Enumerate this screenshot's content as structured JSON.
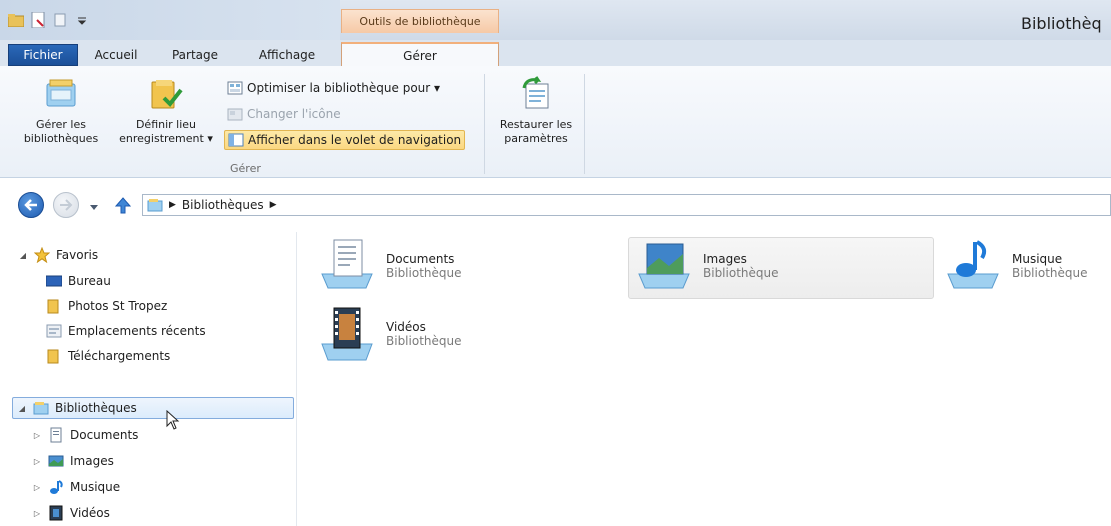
{
  "window": {
    "title": "Bibliothèq",
    "context_header": "Outils de bibliothèque"
  },
  "tabs": [
    {
      "label": "Fichier"
    },
    {
      "label": "Accueil"
    },
    {
      "label": "Partage"
    },
    {
      "label": "Affichage"
    },
    {
      "label": "Gérer"
    }
  ],
  "ribbon": {
    "manage_libraries": {
      "line1": "Gérer les",
      "line2": "bibliothèques"
    },
    "set_save_location": {
      "line1": "Définir lieu",
      "line2": "enregistrement ▾"
    },
    "optimize_library": "Optimiser la bibliothèque pour ▾",
    "change_icon": "Changer l'icône",
    "show_in_nav_pane": "Afficher dans le volet de navigation",
    "group_label": "Gérer",
    "restore_settings": {
      "line1": "Restaurer les",
      "line2": "paramètres"
    }
  },
  "address": {
    "crumb": "Bibliothèques"
  },
  "nav": {
    "favorites": "Favoris",
    "favorites_items": [
      "Bureau",
      "Photos St Tropez",
      "Emplacements récents",
      "Téléchargements"
    ],
    "libraries": "Bibliothèques",
    "libraries_items": [
      "Documents",
      "Images",
      "Musique",
      "Vidéos"
    ]
  },
  "content": {
    "tiles": [
      {
        "name": "Documents",
        "type": "Bibliothèque"
      },
      {
        "name": "Images",
        "type": "Bibliothèque"
      },
      {
        "name": "Musique",
        "type": "Bibliothèque"
      },
      {
        "name": "Vidéos",
        "type": "Bibliothèque"
      }
    ]
  },
  "colors": {
    "file_tab": "#2a68b8",
    "context_tab": "#f6c9a6",
    "highlight": "#fbd882",
    "selection": "#dcecfc"
  }
}
